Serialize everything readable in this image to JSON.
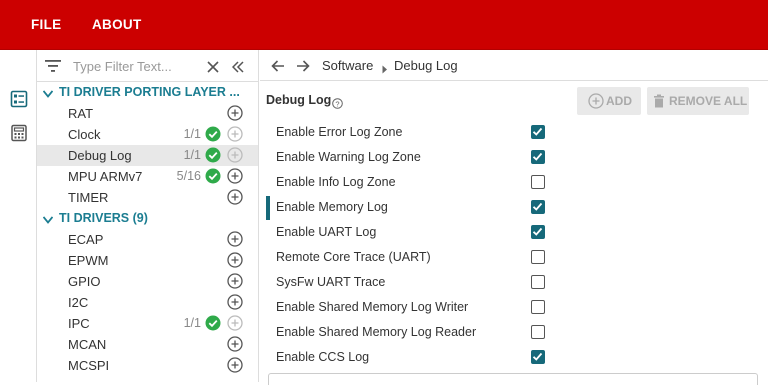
{
  "menu": {
    "file": "FILE",
    "about": "ABOUT"
  },
  "rail": {
    "icons": [
      "module-list-icon",
      "calculator-icon"
    ]
  },
  "filter": {
    "placeholder": "Type Filter Text..."
  },
  "tree": {
    "groups": [
      {
        "label": "TI DRIVER PORTING LAYER ..."
      },
      {
        "label": "TI DRIVERS (9)"
      }
    ],
    "items": [
      {
        "label": "RAT",
        "count": ""
      },
      {
        "label": "Clock",
        "count": "1/1"
      },
      {
        "label": "Debug Log",
        "count": "1/1"
      },
      {
        "label": "MPU ARMv7",
        "count": "5/16"
      },
      {
        "label": "TIMER",
        "count": ""
      },
      {
        "label": "ECAP",
        "count": ""
      },
      {
        "label": "EPWM",
        "count": ""
      },
      {
        "label": "GPIO",
        "count": ""
      },
      {
        "label": "I2C",
        "count": ""
      },
      {
        "label": "IPC",
        "count": "1/1"
      },
      {
        "label": "MCAN",
        "count": ""
      },
      {
        "label": "MCSPI",
        "count": ""
      }
    ]
  },
  "breadcrumb": {
    "root": "Software",
    "current": "Debug Log"
  },
  "panel": {
    "title": "Debug Log",
    "add_label": "ADD",
    "remove_label": "REMOVE ALL",
    "options": [
      {
        "label": "Enable Error Log Zone",
        "checked": true
      },
      {
        "label": "Enable Warning Log Zone",
        "checked": true
      },
      {
        "label": "Enable Info Log Zone",
        "checked": false
      },
      {
        "label": "Enable Memory Log",
        "checked": true
      },
      {
        "label": "Enable UART Log",
        "checked": true
      },
      {
        "label": "Remote Core Trace (UART)",
        "checked": false
      },
      {
        "label": "SysFw UART Trace",
        "checked": false
      },
      {
        "label": "Enable Shared Memory Log Writer",
        "checked": false
      },
      {
        "label": "Enable Shared Memory Log Reader",
        "checked": false
      },
      {
        "label": "Enable CCS Log",
        "checked": true
      }
    ]
  },
  "colors": {
    "brand_red": "#cc0000",
    "accent_teal": "#16697a",
    "ok_green": "#2faa4a"
  }
}
